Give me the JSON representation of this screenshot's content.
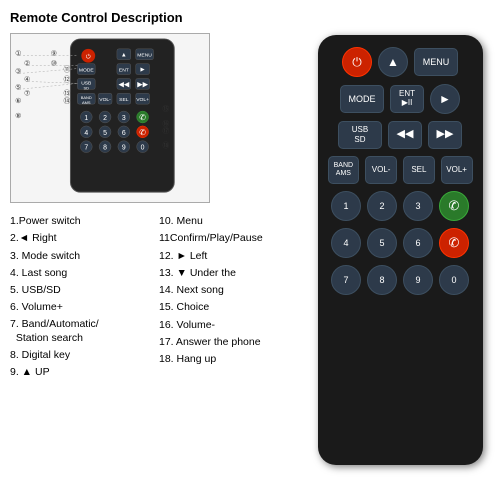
{
  "title": "Remote Control Description",
  "descriptions_left": [
    "1.Power switch",
    "2.◄ Right",
    "3. Mode switch",
    "4. Last song",
    "5. USB/SD",
    "6. Volume+",
    "7. Band/Automatic/\n  Station search",
    "8. Digital key",
    "9. ▲ UP"
  ],
  "descriptions_right": [
    "10. Menu",
    "11Confirm/Play/Pause",
    "12. ► Left",
    "13. ▼ Under the",
    "14. Next song",
    "15. Choice",
    "16. Volume-",
    "17. Answer the phone",
    "18. Hang up"
  ],
  "remote": {
    "rows": [
      [
        "⏻",
        "▲",
        "MENU"
      ],
      [
        "MODE",
        "ENT\n▶II",
        "▶"
      ],
      [
        "USB\nSD",
        "◀◀",
        "▶▶"
      ],
      [
        "BAND\nAMS",
        "VOL-",
        "SEL",
        "VOL+"
      ],
      [
        "1",
        "2",
        "3",
        "✆"
      ],
      [
        "4",
        "5",
        "6",
        "✆"
      ],
      [
        "7",
        "8",
        "9",
        "0"
      ]
    ]
  }
}
